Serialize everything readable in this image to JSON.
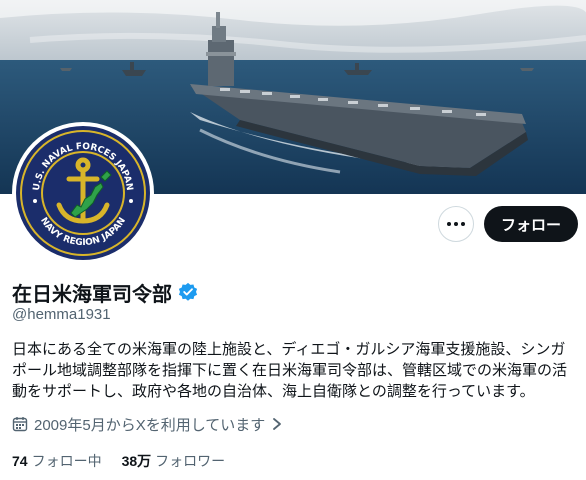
{
  "profile": {
    "display_name": "在日米海軍司令部",
    "handle": "@hemma1931",
    "bio": "日本にある全ての米海軍の陸上施設と、ディエゴ・ガルシア海軍支援施設、シンガ\nポール地域調整部隊を指揮下に置く在日米海軍司令部は、管轄区域での米海軍の活\n動をサポートし、政府や各地の自治体、海上自衛隊との調整を行っています。",
    "joined_text": "2009年5月からXを利用しています",
    "verified_color": "#1d9bf0"
  },
  "avatar": {
    "seal_top_text": "U.S. NAVAL FORCES JAPAN",
    "seal_bottom_text": "NAVY REGION JAPAN"
  },
  "actions": {
    "more_icon": "ellipsis-icon",
    "follow_label": "フォロー"
  },
  "stats": {
    "following_count": "74",
    "following_label": "フォロー中",
    "followers_count": "38万",
    "followers_label": "フォロワー"
  },
  "colors": {
    "text_primary": "#0f1419",
    "text_secondary": "#536471",
    "button_dark": "#0f1419",
    "seal_navy": "#1b2d6b",
    "seal_gold": "#d8b52a"
  }
}
